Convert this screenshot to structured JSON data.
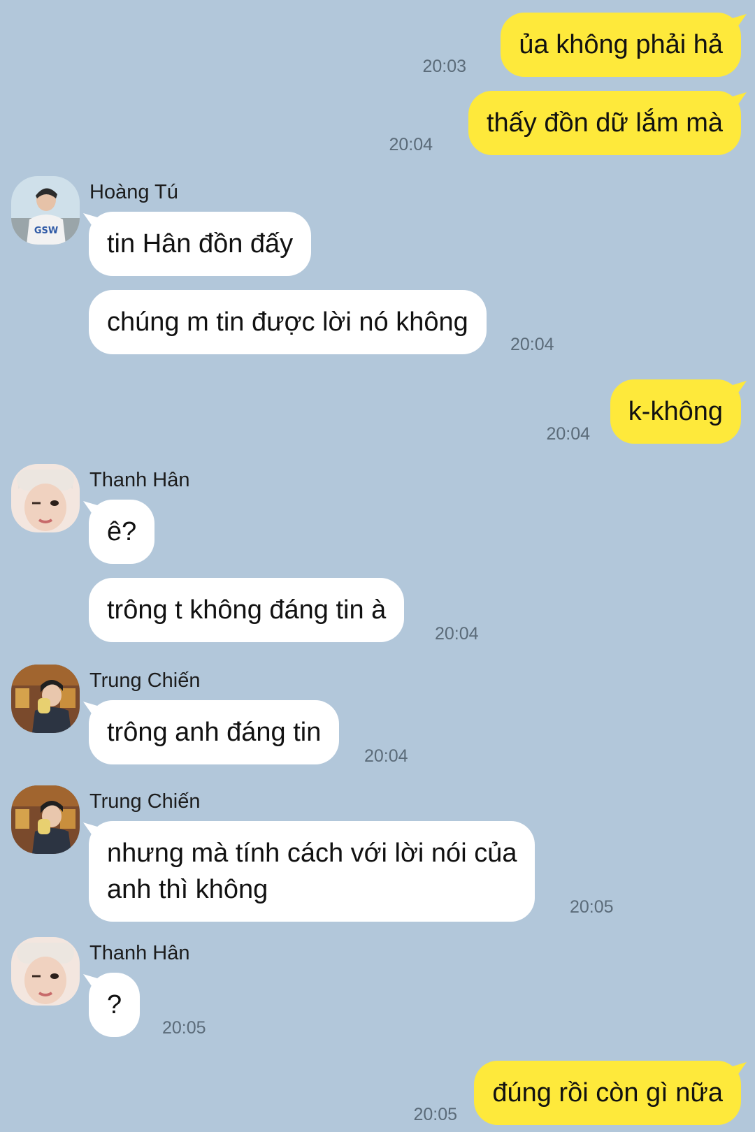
{
  "messages": [
    {
      "text": "ủa không phải hả",
      "time": "20:03"
    },
    {
      "text": "thấy đồn dữ lắm mà",
      "time": "20:04"
    },
    {
      "sender": "Hoàng Tú",
      "text": "tin Hân đồn đấy"
    },
    {
      "text": "chúng m tin được lời nó không",
      "time": "20:04"
    },
    {
      "text": "k-không",
      "time": "20:04"
    },
    {
      "sender": "Thanh Hân",
      "text": "ê?"
    },
    {
      "text": "trông t không đáng tin à",
      "time": "20:04"
    },
    {
      "sender": "Trung Chiến",
      "text": "trông anh đáng tin",
      "time": "20:04"
    },
    {
      "sender": "Trung Chiến",
      "text": "nhưng mà tính cách với lời nói của\nanh thì không",
      "time": "20:05"
    },
    {
      "sender": "Thanh Hân",
      "text": "?",
      "time": "20:05"
    },
    {
      "text": "đúng rồi còn gì nữa",
      "time": "20:05"
    }
  ],
  "colors": {
    "background": "#b2c7da",
    "outgoing_bubble": "#fee93b",
    "incoming_bubble": "#ffffff",
    "timestamp": "#5b6b79"
  }
}
